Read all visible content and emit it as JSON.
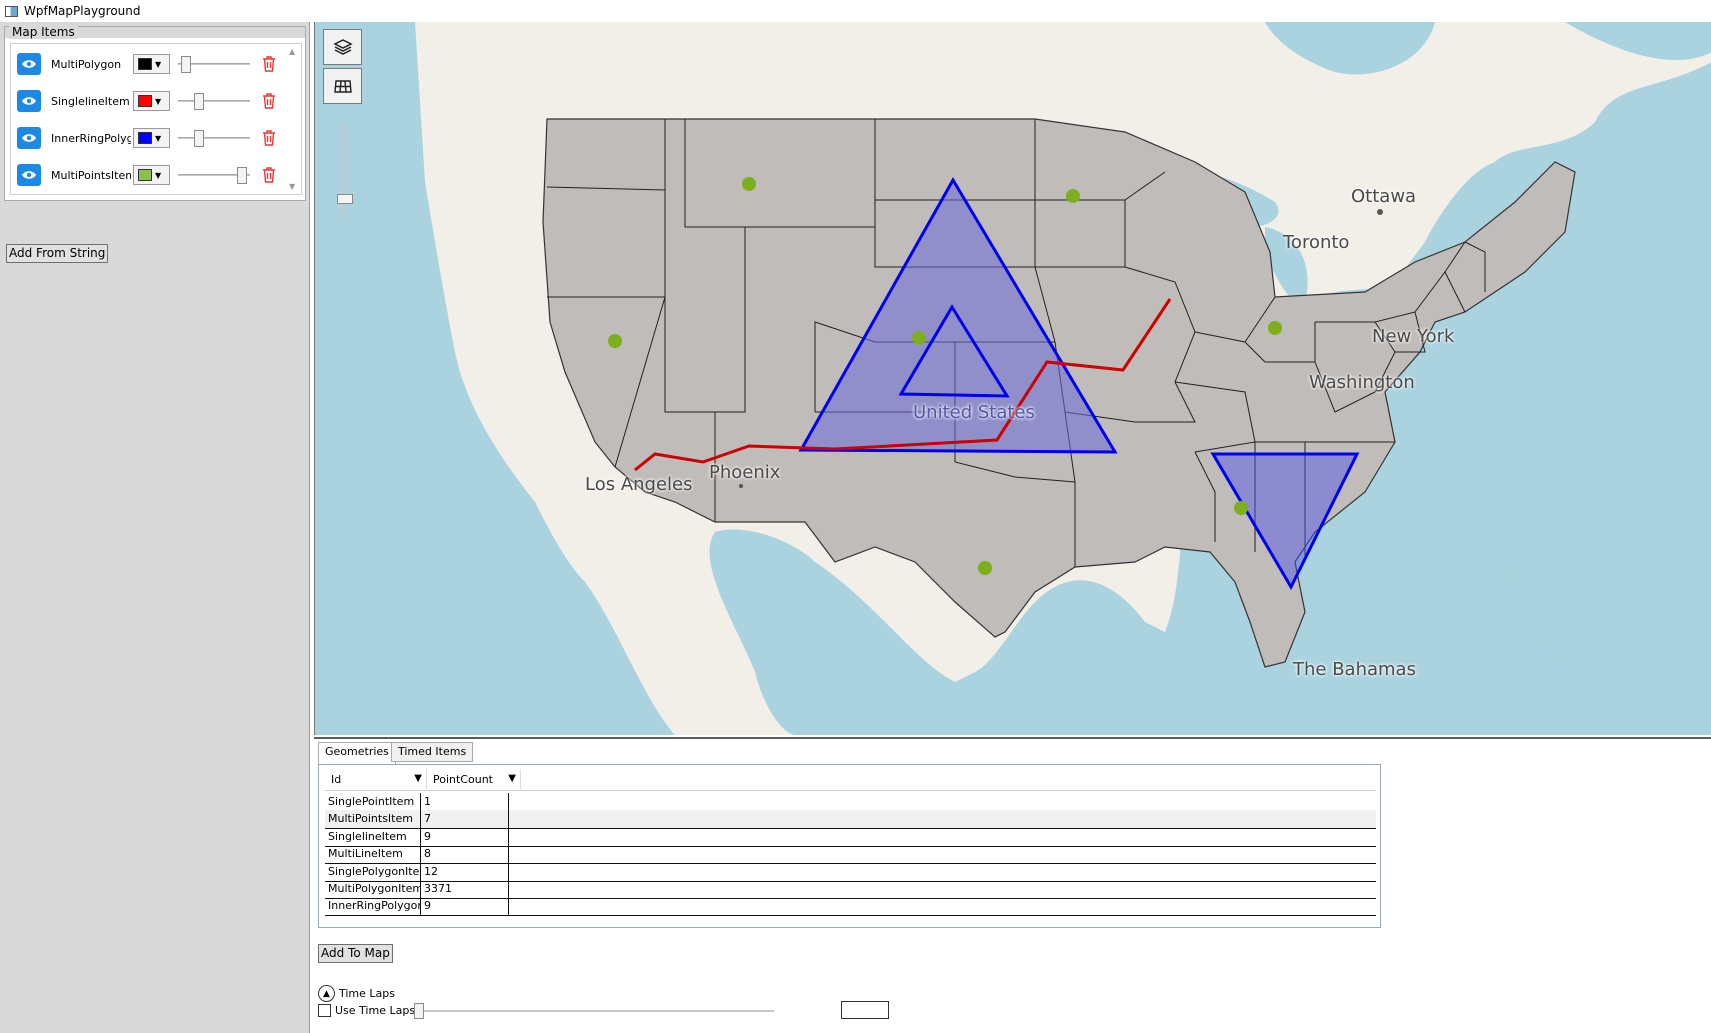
{
  "window": {
    "title": "WpfMapPlayground"
  },
  "left_panel": {
    "group_title": "Map Items",
    "items": [
      {
        "label": "MultiPolygon",
        "color": "#000000",
        "slider": 0.05
      },
      {
        "label": "SinglelineItem",
        "color": "#ff0000",
        "slider": 0.25
      },
      {
        "label": "InnerRingPolygons",
        "color": "#0000ff",
        "slider": 0.25
      },
      {
        "label": "MultiPointsItem",
        "color": "#8bc34a",
        "slider": 0.95
      }
    ],
    "add_button": "Add From String"
  },
  "map": {
    "labels": {
      "ottawa": "Ottawa",
      "toronto": "Toronto",
      "new_york": "New York",
      "washington": "Washington",
      "united_states": "United States",
      "phoenix": "Phoenix",
      "los_angeles": "Los Angeles",
      "bahamas": "The Bahamas"
    },
    "colors": {
      "water": "#aad3df",
      "land": "#f2efe9",
      "states": "#c0bcb9",
      "polygon": "#6a6ad8",
      "line": "#cc0000",
      "point": "#7cae1e"
    }
  },
  "tabs": [
    {
      "label": "Geometries",
      "active": true
    },
    {
      "label": "Timed Items",
      "active": false
    }
  ],
  "grid": {
    "columns": [
      "Id",
      "PointCount"
    ],
    "rows": [
      {
        "id": "SinglePointItem",
        "count": "1"
      },
      {
        "id": "MultiPointsItem",
        "count": "7"
      },
      {
        "id": "SinglelineItem",
        "count": "9"
      },
      {
        "id": "MultiLineItem",
        "count": "8"
      },
      {
        "id": "SinglePolygonItem",
        "count": "12"
      },
      {
        "id": "MultiPolygonItem",
        "count": "3371"
      },
      {
        "id": "InnerRingPolygons",
        "count": "9"
      }
    ]
  },
  "bottom": {
    "add_to_map": "Add To Map",
    "time_laps_header": "Time Laps",
    "use_time_laps": "Use Time Laps",
    "use_time_laps_checked": false
  }
}
